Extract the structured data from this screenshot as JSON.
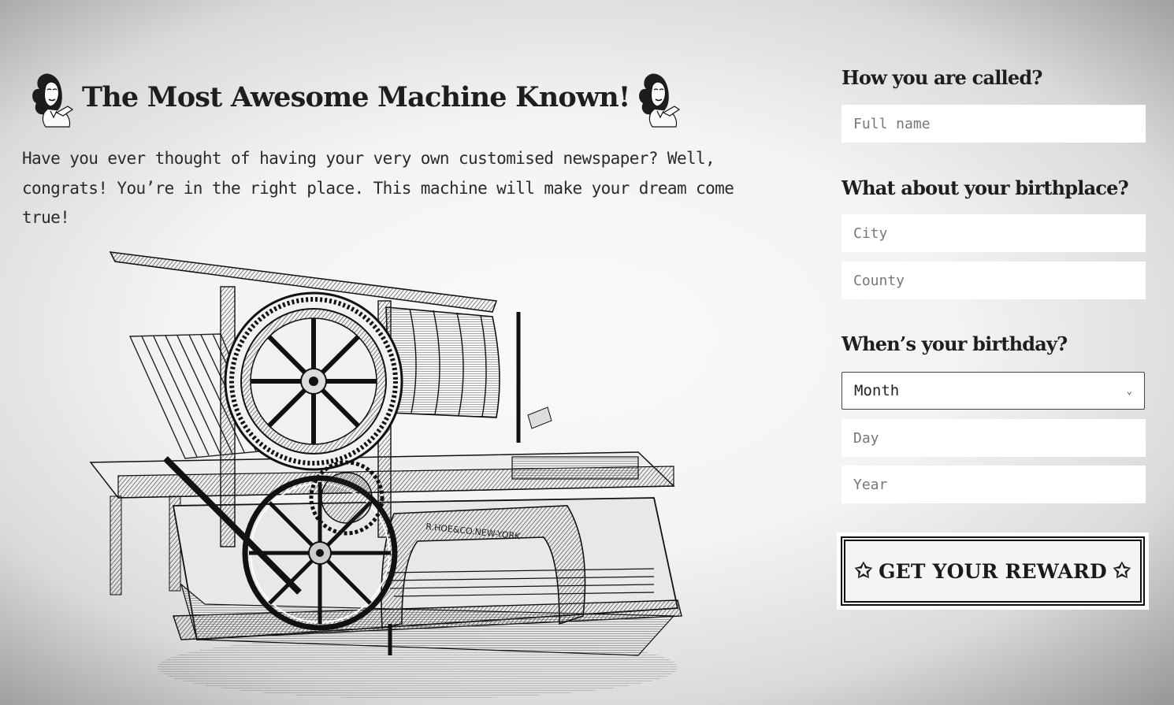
{
  "header": {
    "title": "The Most Awesome Machine Known!",
    "left_icon": "retro-lady-icon",
    "right_icon": "retro-lady-icon"
  },
  "intro": {
    "text": "Have you ever thought of having your very own customised newspaper? Well, congrats! You’re in the right place. This machine will make your dream come true!"
  },
  "illustration": {
    "name": "printing-press-illustration",
    "engraved_text": "R.HOE&CO.NEW-YORK"
  },
  "form": {
    "name_question": "How you are called?",
    "full_name_placeholder": "Full name",
    "birthplace_question": "What about your birthplace?",
    "city_placeholder": "City",
    "county_placeholder": "County",
    "birthday_question": "When’s your birthday?",
    "month_value": "Month",
    "day_placeholder": "Day",
    "year_placeholder": "Year",
    "submit_label": "GET YOUR REWARD",
    "submit_star": "✩"
  },
  "colors": {
    "text": "#222222",
    "field_bg": "#ffffff",
    "button_border": "#111111"
  }
}
